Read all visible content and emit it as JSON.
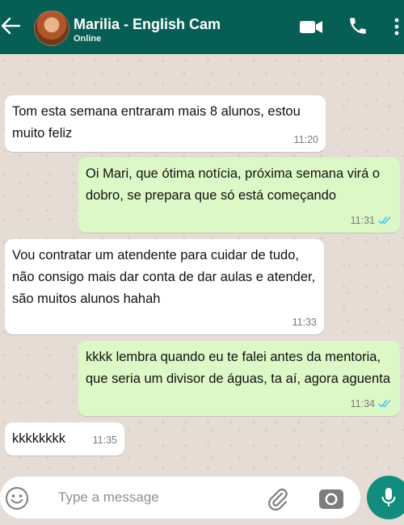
{
  "header": {
    "contact_name": "Marilia - English Cam",
    "status": "Online",
    "icons": [
      "back-arrow-icon",
      "video-call-icon",
      "phone-icon",
      "more-options-icon"
    ]
  },
  "messages": [
    {
      "direction": "in",
      "text": "Tom esta semana entraram mais 8 alunos, estou muito feliz",
      "time": "11:20"
    },
    {
      "direction": "out",
      "text": "Oi Mari, que ótima notícia, próxima semana virá o dobro, se prepara que só está começando",
      "time": "11:31",
      "read": true
    },
    {
      "direction": "in",
      "text": "Vou contratar um atendente para cuidar de tudo, não consigo mais dar conta de dar aulas e atender, são muitos alunos hahah",
      "time": "11:33"
    },
    {
      "direction": "out",
      "text": "kkkk lembra quando eu te falei antes da mentoria, que seria um divisor de águas, ta aí, agora aguenta",
      "time": "11:34",
      "read": true
    },
    {
      "direction": "in",
      "text": "kkkkkkkk",
      "time": "11:35"
    }
  ],
  "composer": {
    "placeholder": "Type a message",
    "icons": [
      "emoji-icon",
      "paperclip-icon",
      "camera-icon",
      "microphone-icon"
    ]
  },
  "colors": {
    "header": "#075e54",
    "incoming_bubble": "#ffffff",
    "outgoing_bubble": "#dcf8c6",
    "chat_background": "#e5ddd5",
    "mic_button": "#128c7e",
    "read_check": "#4fc3f7"
  }
}
